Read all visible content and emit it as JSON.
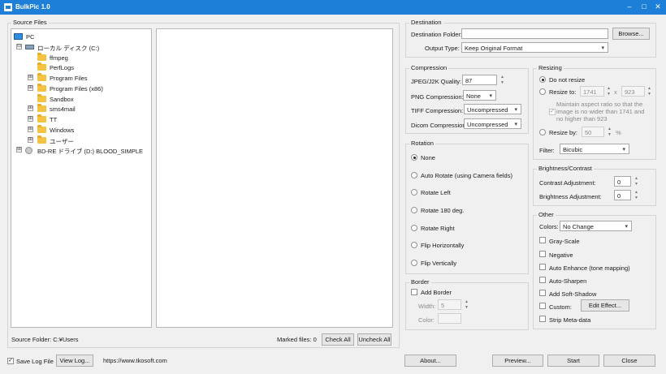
{
  "window": {
    "title": "BulkPic 1.0",
    "minimize": "–",
    "maximize": "□",
    "close": "✕"
  },
  "source": {
    "group_label": "Source Files",
    "tree": [
      {
        "label": "PC",
        "kind": "monitor",
        "level": 0,
        "expander": ""
      },
      {
        "label": "ローカル ディスク (C:)",
        "kind": "drive",
        "level": 1,
        "expander": "⊟"
      },
      {
        "label": "ffmpeg",
        "kind": "folder",
        "level": 2,
        "expander": ""
      },
      {
        "label": "PerfLogs",
        "kind": "folder",
        "level": 2,
        "expander": ""
      },
      {
        "label": "Program Files",
        "kind": "folder",
        "level": 2,
        "expander": "⊞"
      },
      {
        "label": "Program Files (x86)",
        "kind": "folder",
        "level": 2,
        "expander": "⊞"
      },
      {
        "label": "Sandbox",
        "kind": "folder",
        "level": 2,
        "expander": ""
      },
      {
        "label": "sms4mail",
        "kind": "folder",
        "level": 2,
        "expander": "⊞"
      },
      {
        "label": "TT",
        "kind": "folder",
        "level": 2,
        "expander": "⊞"
      },
      {
        "label": "Windows",
        "kind": "folder",
        "level": 2,
        "expander": "⊞"
      },
      {
        "label": "ユーザー",
        "kind": "folder",
        "level": 2,
        "expander": "⊞"
      },
      {
        "label": "BD-RE ドライブ (D:) BLOOD_SIMPLE",
        "kind": "disc",
        "level": 1,
        "expander": "⊞"
      }
    ],
    "source_folder": "Source Folder: C:¥Users",
    "marked_files": "Marked files: 0",
    "check_all": "Check All",
    "uncheck_all": "Uncheck All"
  },
  "destination": {
    "group_label": "Destination",
    "folder_label": "Destination Folder:",
    "folder_value": "",
    "browse": "Browse...",
    "output_type_label": "Output Type:",
    "output_type_value": "Keep Original Format"
  },
  "compression": {
    "group_label": "Compression",
    "jpeg_label": "JPEG/J2K Quality:",
    "jpeg_value": "87",
    "png_label": "PNG Compression:",
    "png_value": "None",
    "tiff_label": "TIFF Compression:",
    "tiff_value": "Uncompressed",
    "dicom_label": "Dicom Compression:",
    "dicom_value": "Uncompressed"
  },
  "rotation": {
    "group_label": "Rotation",
    "options": [
      "None",
      "Auto Rotate (using Camera fields)",
      "Rotate Left",
      "Rotate 180 deg.",
      "Rotate Right",
      "Flip Horizontally",
      "Flip Vertically"
    ],
    "selected": 0
  },
  "border": {
    "group_label": "Border",
    "add_border": "Add Border",
    "width_label": "Width:",
    "width_value": "5",
    "color_label": "Color:"
  },
  "resizing": {
    "group_label": "Resizing",
    "do_not_resize": "Do not resize",
    "resize_to": "Resize to:",
    "width_value": "1741",
    "x": "x",
    "height_value": "923",
    "aspect_text": "Maintain aspect ratio so that the image is no wider than 1741 and no higher than 923",
    "resize_by": "Resize by:",
    "percent_value": "50",
    "percent": "%",
    "filter_label": "Filter:",
    "filter_value": "Bicubic"
  },
  "brightness": {
    "group_label": "Brightness/Contrast",
    "contrast_label": "Contrast Adjustment:",
    "contrast_value": "0",
    "brightness_label": "Brightness Adjustment:",
    "brightness_value": "0"
  },
  "other": {
    "group_label": "Other",
    "colors_label": "Colors:",
    "colors_value": "No Change",
    "gray_scale": "Gray-Scale",
    "negative": "Negative",
    "auto_enhance": "Auto Enhance (tone mapping)",
    "auto_sharpen": "Auto-Sharpen",
    "add_soft_shadow": "Add Soft-Shadow",
    "custom": "Custom:",
    "edit_effect": "Edit Effect...",
    "strip_meta": "Strip Meta-data"
  },
  "footer": {
    "save_log": "Save Log File",
    "view_log": "View Log...",
    "url": "https://www.tkosoft.com",
    "about": "About...",
    "preview": "Preview...",
    "start": "Start",
    "close": "Close"
  },
  "glyphs": {
    "check": "✓",
    "up": "▲",
    "down": "▼",
    "caret": "▾"
  }
}
